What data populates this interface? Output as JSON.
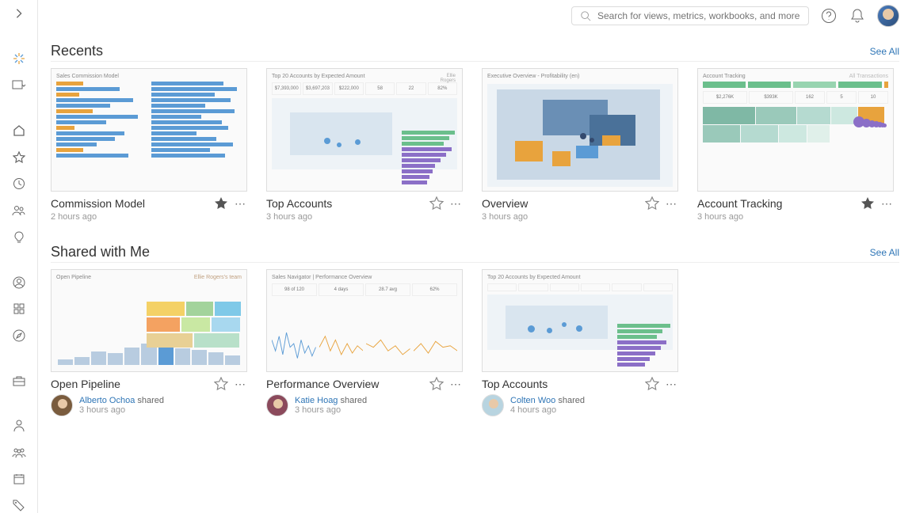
{
  "topbar": {
    "search_placeholder": "Search for views, metrics, workbooks, and more"
  },
  "sections": {
    "recents": {
      "title": "Recents",
      "see_all": "See All"
    },
    "shared": {
      "title": "Shared with Me",
      "see_all": "See All"
    }
  },
  "recents": [
    {
      "title": "Commission Model",
      "time": "2 hours ago",
      "favorite": true,
      "thumb_title": "Sales Commission Model"
    },
    {
      "title": "Top Accounts",
      "time": "3 hours ago",
      "favorite": false,
      "thumb_title": "Top 20 Accounts by Expected Amount",
      "kpis": [
        "$7,393,000",
        "$3,697,203",
        "$222,000",
        "58",
        "22",
        "82%"
      ]
    },
    {
      "title": "Overview",
      "time": "3 hours ago",
      "favorite": false,
      "thumb_title": "Executive Overview - Profitability (en)"
    },
    {
      "title": "Account Tracking",
      "time": "3 hours ago",
      "favorite": true,
      "thumb_title": "Account Tracking",
      "thumb_sub": "All Transactions",
      "kpis": [
        "$2,276K",
        "$393K",
        "162",
        "5",
        "10"
      ]
    }
  ],
  "shared": [
    {
      "title": "Open Pipeline",
      "name": "Alberto Ochoa",
      "shared_label": "shared",
      "time": "3 hours ago",
      "thumb_title": "Open Pipeline",
      "thumb_sub": "Ellie Rogers's team"
    },
    {
      "title": "Performance Overview",
      "name": "Katie Hoag",
      "shared_label": "shared",
      "time": "3 hours ago",
      "thumb_title": "Sales Navigator | Performance Overview"
    },
    {
      "title": "Top Accounts",
      "name": "Colten Woo",
      "shared_label": "shared",
      "time": "4 hours ago",
      "thumb_title": "Top 20 Accounts by Expected Amount"
    }
  ]
}
